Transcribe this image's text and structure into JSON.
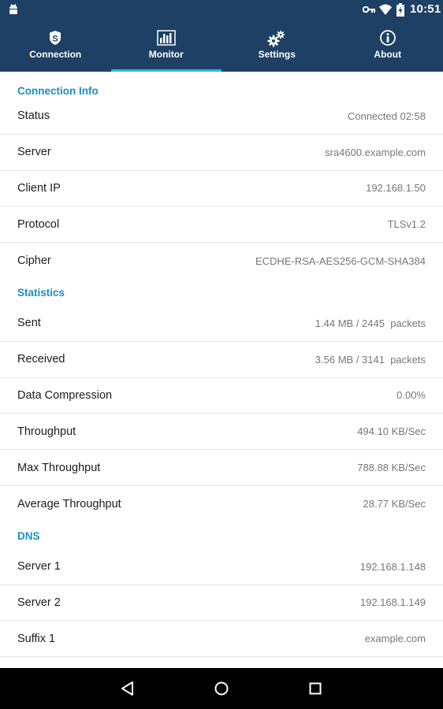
{
  "status_bar": {
    "time": "10:51"
  },
  "tabs": [
    {
      "label": "Connection",
      "icon": "shield-s-icon",
      "active": false
    },
    {
      "label": "Monitor",
      "icon": "bar-chart-icon",
      "active": true
    },
    {
      "label": "Settings",
      "icon": "gears-icon",
      "active": false
    },
    {
      "label": "About",
      "icon": "info-icon",
      "active": false
    }
  ],
  "sections": {
    "connection_info": {
      "title": "Connection Info",
      "rows": [
        {
          "label": "Status",
          "value": "Connected 02:58"
        },
        {
          "label": "Server",
          "value": "sra4600.example.com"
        },
        {
          "label": "Client IP",
          "value": "192.168.1.50"
        },
        {
          "label": "Protocol",
          "value": "TLSv1.2"
        },
        {
          "label": "Cipher",
          "value": "ECDHE-RSA-AES256-GCM-SHA384"
        }
      ]
    },
    "statistics": {
      "title": "Statistics",
      "rows": [
        {
          "label": "Sent",
          "value": "1.44 MB / 2445  packets"
        },
        {
          "label": "Received",
          "value": "3.56 MB / 3141  packets"
        },
        {
          "label": "Data Compression",
          "value": "0.00%"
        },
        {
          "label": "Throughput",
          "value": "494.10 KB/Sec"
        },
        {
          "label": "Max Throughput",
          "value": "788.88 KB/Sec"
        },
        {
          "label": "Average Throughput",
          "value": "28.77 KB/Sec"
        }
      ]
    },
    "dns": {
      "title": "DNS",
      "rows": [
        {
          "label": "Server 1",
          "value": "192.168.1.148"
        },
        {
          "label": "Server 2",
          "value": "192.168.1.149"
        },
        {
          "label": "Suffix 1",
          "value": "example.com"
        }
      ]
    }
  },
  "colors": {
    "header": "#1d4064",
    "accent": "#33b5e5",
    "section_title": "#1a8fc0"
  }
}
